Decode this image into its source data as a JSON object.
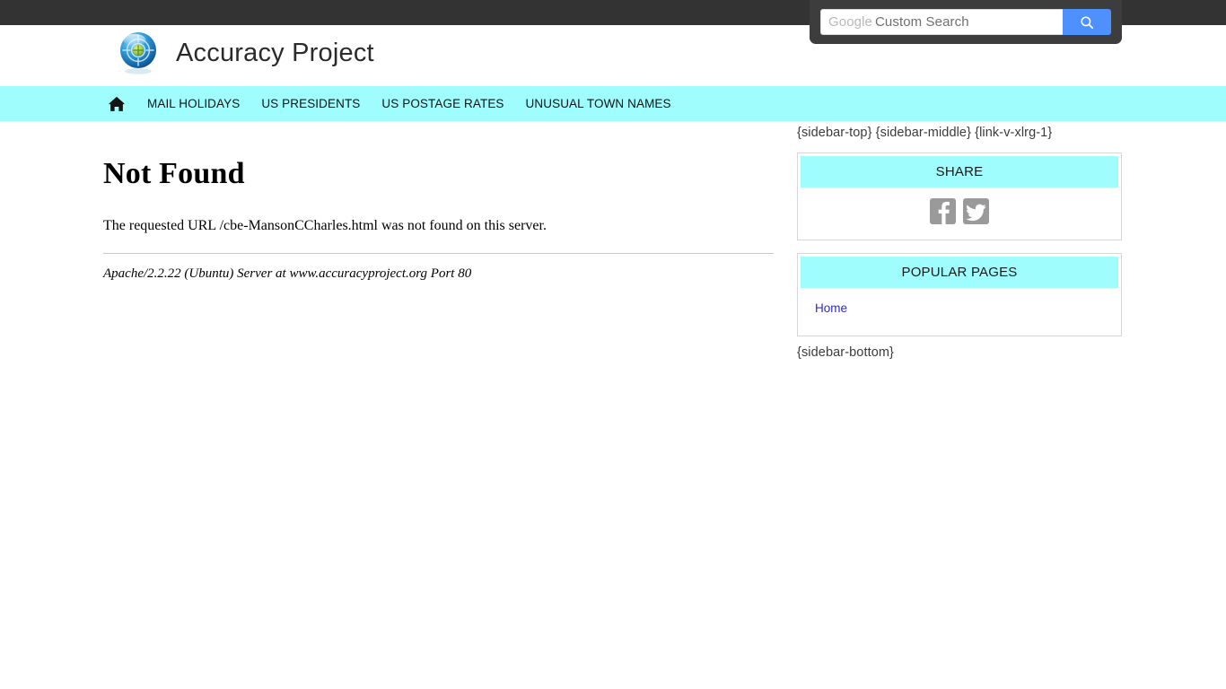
{
  "topbar": {
    "search": {
      "placeholder_brand": "Google",
      "placeholder_text": "Custom Search",
      "value": "",
      "button_icon": "search-icon",
      "button_color": "#4d90fe"
    }
  },
  "header": {
    "logo_icon": "target-globe-logo",
    "title": "Accuracy Project"
  },
  "nav": {
    "background": "#9ffdfd",
    "home_icon": "home-icon",
    "items": [
      {
        "label": "MAIL HOLIDAYS"
      },
      {
        "label": "US PRESIDENTS"
      },
      {
        "label": "US POSTAGE RATES"
      },
      {
        "label": "UNUSUAL TOWN NAMES"
      }
    ]
  },
  "main": {
    "heading": "Not Found",
    "message": "The requested URL /cbe-MansonCCharles.html was not found on this server.",
    "signature": "Apache/2.2.22 (Ubuntu) Server at www.accuracyproject.org Port 80"
  },
  "sidebar": {
    "token_top": "{sidebar-top} {sidebar-middle} {link-v-xlrg-1}",
    "token_bottom": "{sidebar-bottom}",
    "share": {
      "title": "SHARE",
      "icons": [
        {
          "name": "facebook-icon"
        },
        {
          "name": "twitter-icon"
        }
      ]
    },
    "popular": {
      "title": "POPULAR PAGES",
      "links": [
        {
          "label": "Home"
        }
      ]
    }
  }
}
